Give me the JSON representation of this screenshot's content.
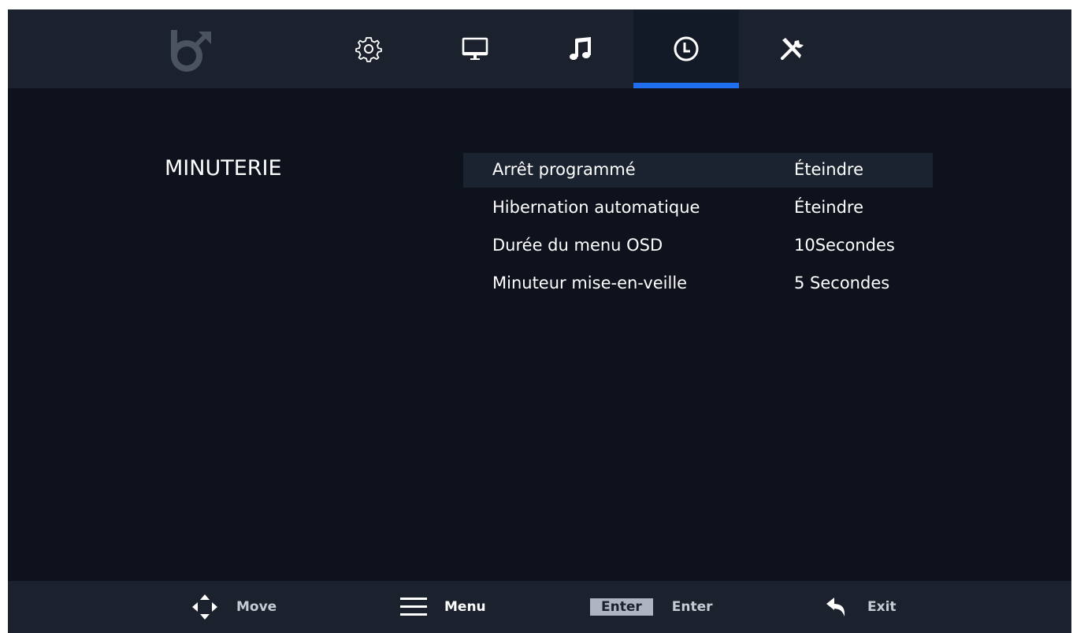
{
  "topbar": {
    "logo_icon": "brand-logo-icon",
    "tabs": [
      {
        "icon": "gear-icon",
        "name": "settings",
        "active": false
      },
      {
        "icon": "monitor-icon",
        "name": "display",
        "active": false
      },
      {
        "icon": "music-note-icon",
        "name": "audio",
        "active": false
      },
      {
        "icon": "clock-icon",
        "name": "timer",
        "active": true
      },
      {
        "icon": "tools-icon",
        "name": "tools",
        "active": false
      }
    ],
    "accent_color": "#1f6ef0"
  },
  "section": {
    "title": "MINUTERIE"
  },
  "menu": {
    "items": [
      {
        "label": "Arrêt programmé",
        "value": "Éteindre",
        "selected": true
      },
      {
        "label": "Hibernation automatique",
        "value": "Éteindre",
        "selected": false
      },
      {
        "label": "Durée du menu OSD",
        "value": "10Secondes",
        "selected": false
      },
      {
        "label": "Minuteur mise-en-veille",
        "value": "5 Secondes",
        "selected": false
      }
    ]
  },
  "footer": {
    "move_label": "Move",
    "menu_label": "Menu",
    "enter_key": "Enter",
    "enter_label": "Enter",
    "exit_label": "Exit"
  }
}
